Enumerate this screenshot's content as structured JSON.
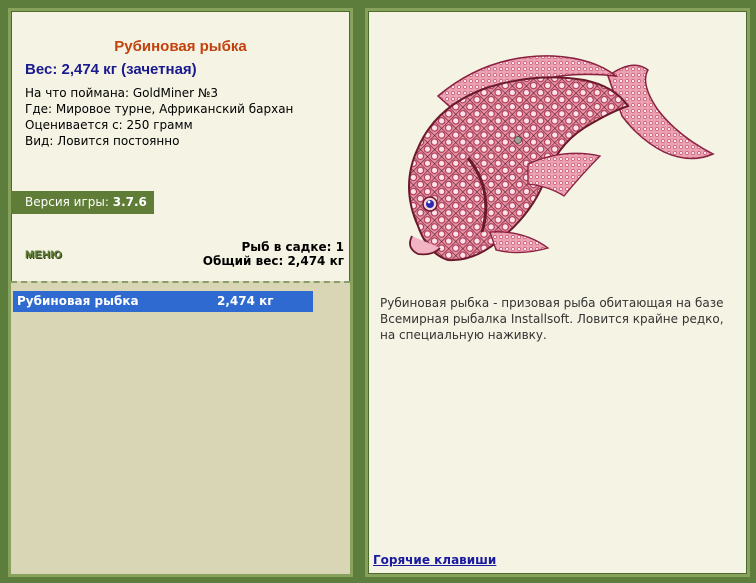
{
  "fish": {
    "name": "Рубиновая рыбка",
    "weight_line": "Вес: 2,474 кг (зачетная)",
    "caught_with": "На что поймана: GoldMiner №3",
    "location": "Где: Мировое турне, Африканский бархан",
    "valued_from": "Оценивается с: 250 грамм",
    "kind": "Вид: Ловится постоянно"
  },
  "version": {
    "label": "Версия игры:",
    "value": "3.7.6"
  },
  "menu": {
    "label": "МЕНЮ"
  },
  "stats": {
    "count_line": "Рыб в садке: 1",
    "total_line": "Общий вес: 2,474 кг"
  },
  "catch_list": [
    {
      "name": "Рубиновая рыбка",
      "weight": "2,474 кг"
    }
  ],
  "description": "Рубиновая рыбка - призовая рыба обитающая на базе Всемирная рыбалка Installsoft. Ловится крайне редко, на специальную наживку.",
  "hotkeys": {
    "label": "Горячие клавиши"
  },
  "colors": {
    "frame_green": "#5d7d3c",
    "panel_bg": "#f5f3e4",
    "title_orange": "#c2410c",
    "weight_navy": "#1a1a8f",
    "selection_blue": "#2f6ad0",
    "fish_ruby": "#d9607a"
  }
}
